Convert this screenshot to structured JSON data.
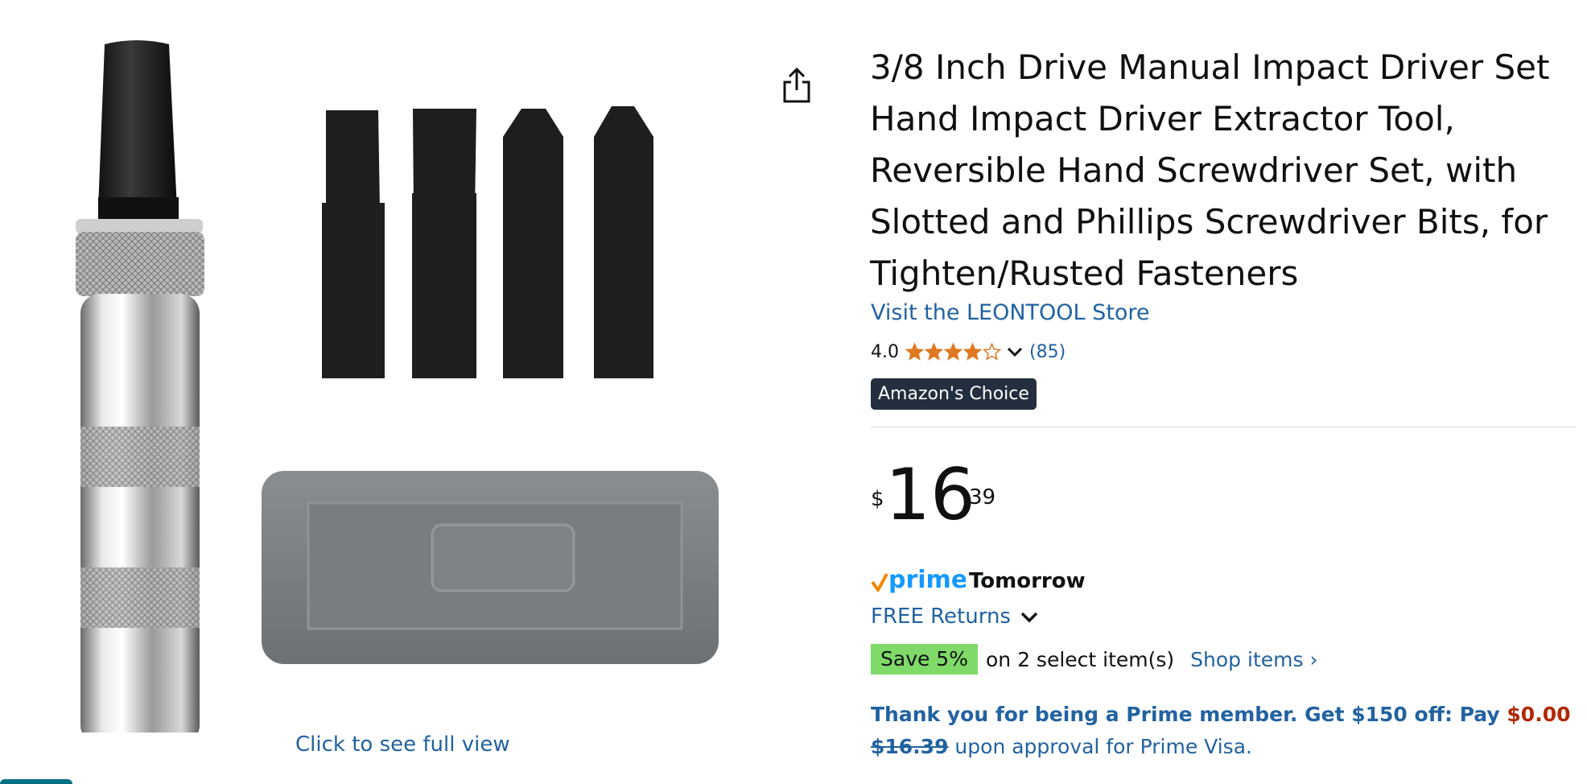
{
  "product": {
    "title": "3/8 Inch Drive Manual Impact Driver Set Hand Impact Driver Extractor Tool, Reversible Hand Screwdriver Set, with Slotted and Phillips Screwdriver Bits, for Tighten/Rusted Fasteners",
    "store_link": "Visit the LEONTOOL Store",
    "rating": "4.0",
    "rating_value": 4.0,
    "review_count": "(85)",
    "badge": "Amazon's Choice"
  },
  "price": {
    "symbol": "$",
    "whole": "16",
    "fraction": "39"
  },
  "delivery": {
    "prime_logo_text": "prime",
    "day": "Tomorrow",
    "returns": "FREE Returns"
  },
  "coupon": {
    "badge": "Save 5%",
    "text": "on 2 select item(s)",
    "link": "Shop items ›"
  },
  "promo": {
    "bold_text": "Thank you for being a Prime member. Get $150 off: Pay ",
    "zero_price": "$0.00",
    "strike_price": "$16.39",
    "rest": " upon approval for Prime Visa."
  },
  "gallery": {
    "see_full_view": "Click to see full view"
  },
  "colors": {
    "link": "#2162a1",
    "star": "#de7921",
    "badge_bg": "#232f3e",
    "save_bg": "#7fda69",
    "price_red": "#b12704"
  },
  "icons": {
    "share": "share-icon",
    "star": "star-icon",
    "chevron": "chevron-down-icon"
  }
}
